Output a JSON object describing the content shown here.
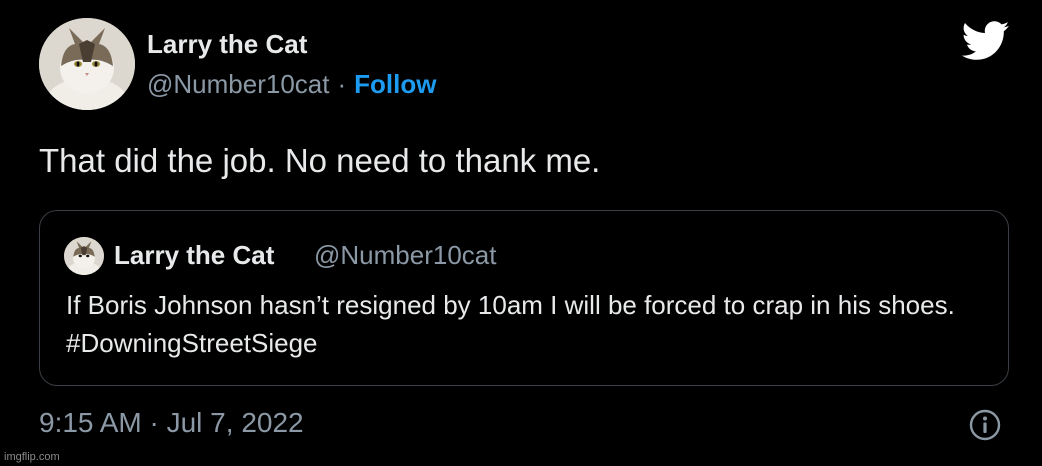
{
  "tweet": {
    "author_name": "Larry the Cat",
    "author_handle": "@Number10cat",
    "separator": "·",
    "follow_label": "Follow",
    "text": "That did the job. No need to thank me.",
    "timestamp": "9:15 AM · Jul 7, 2022"
  },
  "quoted": {
    "author_name": "Larry the Cat",
    "author_handle": "@Number10cat",
    "text": "If Boris Johnson hasn’t resigned by 10am I will be forced to crap in his shoes. #DowningStreetSiege"
  },
  "icons": {
    "brand": "twitter-bird-icon",
    "info": "info-icon"
  },
  "colors": {
    "background": "#000000",
    "primary_text": "#e7e9ea",
    "secondary_text": "#8b98a5",
    "accent": "#1d9bf0"
  },
  "watermark": "imgflip.com"
}
